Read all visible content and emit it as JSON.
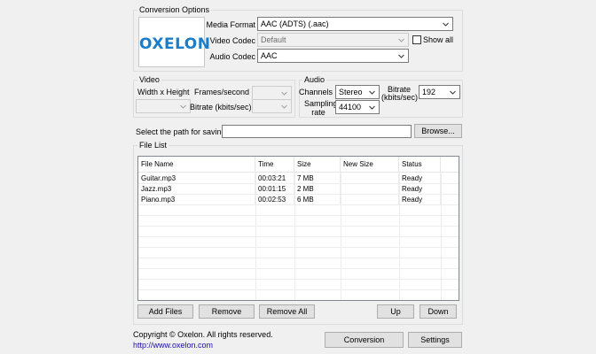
{
  "conversion_options": {
    "title": "Conversion Options",
    "logo_text": "OXELON",
    "media_format_label": "Media Format",
    "media_format_value": "AAC (ADTS) (.aac)",
    "video_codec_label": "Video Codec",
    "video_codec_value": "Default",
    "audio_codec_label": "Audio Codec",
    "audio_codec_value": "AAC",
    "show_all_label": "Show all",
    "show_all_checked": false
  },
  "video": {
    "title": "Video",
    "width_height_label": "Width x Height",
    "width_height_value": "",
    "frames_label": "Frames/second",
    "frames_value": "",
    "bitrate_label": "Bitrate (kbits/sec)",
    "bitrate_value": ""
  },
  "audio": {
    "title": "Audio",
    "channels_label": "Channels",
    "channels_value": "Stereo",
    "sampling_label_1": "Sampling",
    "sampling_label_2": "rate",
    "sampling_value": "44100",
    "bitrate_label_1": "Bitrate",
    "bitrate_label_2": "(kbits/sec)",
    "bitrate_value": "192"
  },
  "save_path": {
    "label": "Select the path for saving:",
    "value": "",
    "browse_label": "Browse..."
  },
  "file_list": {
    "title": "File List",
    "columns": [
      "File Name",
      "Time",
      "Size",
      "New Size",
      "Status"
    ],
    "rows": [
      [
        "Guitar.mp3",
        "00:03:21",
        "7 MB",
        "",
        "Ready"
      ],
      [
        "Jazz.mp3",
        "00:01:15",
        "2 MB",
        "",
        "Ready"
      ],
      [
        "Piano.mp3",
        "00:02:53",
        "6 MB",
        "",
        "Ready"
      ]
    ],
    "add_files_label": "Add Files",
    "remove_label": "Remove",
    "remove_all_label": "Remove All",
    "up_label": "Up",
    "down_label": "Down"
  },
  "footer": {
    "copyright": "Copyright © Oxelon. All rights reserved.",
    "url": "http://www.oxelon.com",
    "conversion_label": "Conversion",
    "settings_label": "Settings"
  },
  "icons": {
    "dropdown": "chevron-down-icon"
  }
}
